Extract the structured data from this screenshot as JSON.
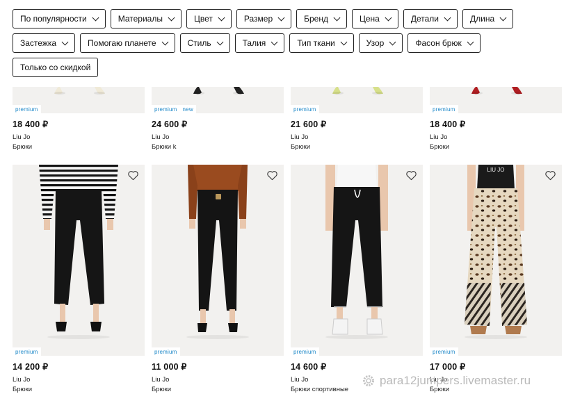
{
  "filters": {
    "row1": [
      "По популярности",
      "Материалы",
      "Цвет",
      "Размер",
      "Бренд",
      "Цена",
      "Детали",
      "Длина"
    ],
    "row2": [
      "Застежка",
      "Помогаю планете",
      "Стиль",
      "Талия",
      "Тип ткани",
      "Узор",
      "Фасон брюк"
    ],
    "discount_only": "Только со скидкой"
  },
  "products_top": [
    {
      "badges": [
        "premium"
      ],
      "price": "18 400 ₽",
      "brand": "Liu Jo",
      "type": "Брюки",
      "shoe_color": "#f0ead8"
    },
    {
      "badges": [
        "premium",
        "new"
      ],
      "price": "24 600 ₽",
      "brand": "Liu Jo",
      "type": "Брюки k",
      "shoe_color": "#222222"
    },
    {
      "badges": [
        "premium"
      ],
      "price": "21 600 ₽",
      "brand": "Liu Jo",
      "type": "Брюки",
      "shoe_color": "#d7e08a"
    },
    {
      "badges": [
        "premium"
      ],
      "price": "18 400 ₽",
      "brand": "Liu Jo",
      "type": "Брюки",
      "shoe_color": "#b01e22"
    }
  ],
  "products_bottom": [
    {
      "badges": [
        "premium"
      ],
      "price": "14 200 ₽",
      "brand": "Liu Jo",
      "type": "Брюки",
      "top": "stripes",
      "pants": "black-cropped"
    },
    {
      "badges": [
        "premium"
      ],
      "price": "11 000 ₽",
      "brand": "Liu Jo",
      "type": "Брюки",
      "top": "rust",
      "pants": "black-slim"
    },
    {
      "badges": [
        "premium"
      ],
      "price": "14 600 ₽",
      "brand": "Liu Jo",
      "type": "Брюки спортивные",
      "top": "white",
      "pants": "black-jogger"
    },
    {
      "badges": [
        "premium"
      ],
      "price": "17 000 ₽",
      "brand": "Liu Jo",
      "type": "Брюки",
      "top": "black-logo",
      "top_text": "LIU JO",
      "pants": "leopard-wide"
    }
  ],
  "icons": {
    "wishlist": "heart-outline-icon",
    "dropdown": "chevron-down-icon"
  },
  "watermark": "para12jumpers.livemaster.ru",
  "colors": {
    "badge_text": "#1e88c8",
    "chip_border": "#222222",
    "image_bg": "#f2f1ef"
  }
}
